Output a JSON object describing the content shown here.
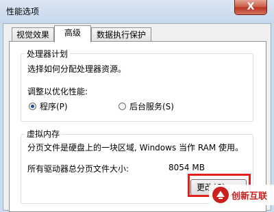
{
  "window": {
    "title": "性能选项",
    "close_label": "X"
  },
  "tabs": [
    {
      "label": "视觉效果",
      "active": false
    },
    {
      "label": "高级",
      "active": true
    },
    {
      "label": "数据执行保护",
      "active": false
    }
  ],
  "processor": {
    "legend": "处理器计划",
    "desc": "选择如何分配处理器资源。",
    "optimize_label": "调整以优化性能:",
    "options": [
      {
        "label": "程序(P)",
        "selected": true
      },
      {
        "label": "后台服务(S)",
        "selected": false
      }
    ]
  },
  "virtual_memory": {
    "legend": "虚拟内存",
    "desc": "分页文件是硬盘上的一块区域, Windows 当作 RAM 使用。",
    "total_label": "所有驱动器总分页文件大小:",
    "total_value": "8054 MB",
    "change_button": "更改(C)..."
  },
  "watermark": {
    "text": "创新互联"
  },
  "colors": {
    "highlight": "#e1201b",
    "watermark": "#c9211e"
  }
}
